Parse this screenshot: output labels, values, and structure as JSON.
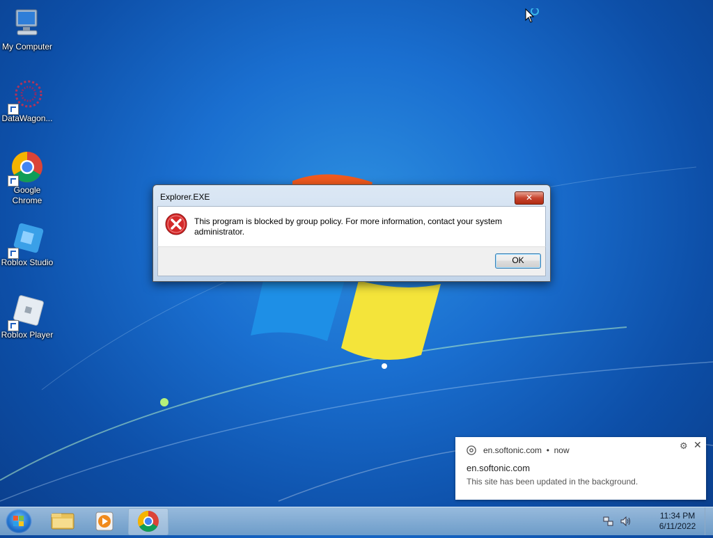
{
  "desktop_icons": [
    {
      "label": "My Computer",
      "icon": "computer-icon"
    },
    {
      "label": "DataWagon...",
      "icon": "datawagon-icon"
    },
    {
      "label": "Google Chrome",
      "icon": "chrome-icon"
    },
    {
      "label": "Roblox Studio",
      "icon": "roblox-studio-icon"
    },
    {
      "label": "Roblox Player",
      "icon": "roblox-player-icon"
    }
  ],
  "dialog": {
    "title": "Explorer.EXE",
    "close_label": "✕",
    "message": "This program is blocked by group policy. For more information, contact your system administrator.",
    "ok_label": "OK",
    "icon": "error-icon"
  },
  "notification": {
    "source": "en.softonic.com",
    "time": "now",
    "title": "en.softonic.com",
    "message": "This site has been updated in the background.",
    "gear": "⚙",
    "close": "✕"
  },
  "taskbar": {
    "pinned": [
      "explorer-icon",
      "media-player-icon",
      "chrome-icon"
    ],
    "clock_time": "11:34 PM",
    "clock_date": "6/11/2022"
  },
  "colors": {
    "desktop_blue": "#1a6fd0",
    "close_red": "#c7452f",
    "error_red": "#d42a2a"
  }
}
